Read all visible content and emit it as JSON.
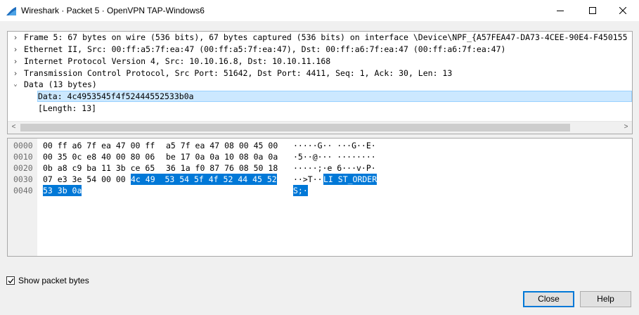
{
  "window": {
    "title": "Wireshark · Packet 5 · OpenVPN TAP-Windows6",
    "accent_color": "#0078d7"
  },
  "tree": {
    "items": [
      {
        "text": "Frame 5: 67 bytes on wire (536 bits), 67 bytes captured (536 bits) on interface \\Device\\NPF_{A57FEA47-DA73-4CEE-90E4-F450155",
        "expander": "collapsed"
      },
      {
        "text": "Ethernet II, Src: 00:ff:a5:7f:ea:47 (00:ff:a5:7f:ea:47), Dst: 00:ff:a6:7f:ea:47 (00:ff:a6:7f:ea:47)",
        "expander": "collapsed"
      },
      {
        "text": "Internet Protocol Version 4, Src: 10.10.16.8, Dst: 10.10.11.168",
        "expander": "collapsed"
      },
      {
        "text": "Transmission Control Protocol, Src Port: 51642, Dst Port: 4411, Seq: 1, Ack: 30, Len: 13",
        "expander": "collapsed"
      },
      {
        "text": "Data (13 bytes)",
        "expander": "expanded"
      },
      {
        "text": "Data: 4c4953545f4f52444552533b0a",
        "expander": "none",
        "selected": true
      },
      {
        "text": "[Length: 13]",
        "expander": "none"
      }
    ]
  },
  "hex": {
    "rows": [
      {
        "offset": "0000",
        "hex_a": "00 ff a6 7f ea 47 00 ff",
        "hex_b": "a5 7f ea 47 08 00 45 00",
        "ascii": "·····G·· ···G··E·"
      },
      {
        "offset": "0010",
        "hex_a": "00 35 0c e8 40 00 80 06",
        "hex_b": "be 17 0a 0a 10 08 0a 0a",
        "ascii": "·5··@··· ········"
      },
      {
        "offset": "0020",
        "hex_a": "0b a8 c9 ba 11 3b ce 65",
        "hex_b": "36 1a f0 87 76 08 50 18",
        "ascii": "·····;·e 6···v·P·"
      },
      {
        "offset": "0030",
        "hex_a": "07 e3 3e 54 00 00",
        "hex_hl": "4c 49  53 54 5f 4f 52 44 45 52",
        "ascii_plain": "··>T··",
        "ascii_hl": "LI ST_ORDER"
      },
      {
        "offset": "0040",
        "hex_hl": "53 3b 0a",
        "ascii_hl": "S;·"
      }
    ]
  },
  "options": {
    "show_packet_bytes_label": "Show packet bytes",
    "show_packet_bytes_checked": true
  },
  "buttons": {
    "close_label": "Close",
    "help_label": "Help"
  }
}
